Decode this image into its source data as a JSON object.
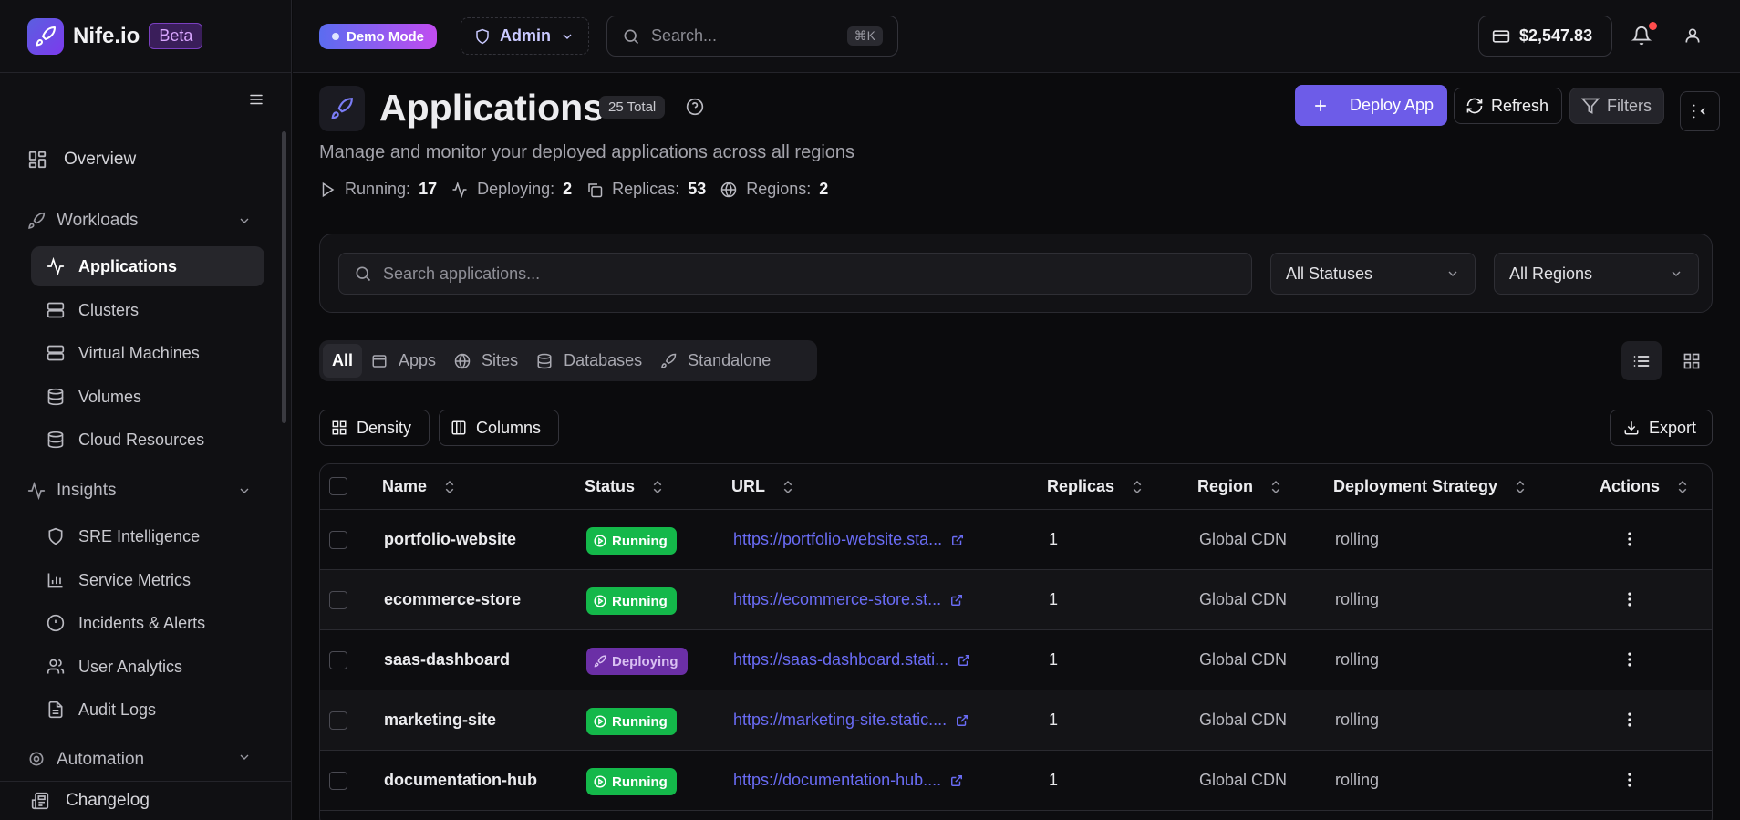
{
  "brand": {
    "name": "Nife.io",
    "badge": "Beta"
  },
  "sidebar": {
    "overview": "Overview",
    "groups": [
      {
        "label": "Workloads",
        "items": [
          "Applications",
          "Clusters",
          "Virtual Machines",
          "Volumes",
          "Cloud Resources"
        ]
      },
      {
        "label": "Insights",
        "items": [
          "SRE Intelligence",
          "Service Metrics",
          "Incidents & Alerts",
          "User Analytics",
          "Audit Logs"
        ]
      },
      {
        "label": "Automation"
      }
    ],
    "active_item": "Applications",
    "changelog": "Changelog"
  },
  "topbar": {
    "demo_mode": "Demo Mode",
    "role": "Admin",
    "search_placeholder": "Search...",
    "search_shortcut": "⌘K",
    "balance": "$2,547.83"
  },
  "page": {
    "title": "Applications",
    "total_badge": "25 Total",
    "subtitle": "Manage and monitor your deployed applications across all regions",
    "stats": [
      {
        "label": "Running:",
        "value": "17"
      },
      {
        "label": "Deploying:",
        "value": "2"
      },
      {
        "label": "Replicas:",
        "value": "53"
      },
      {
        "label": "Regions:",
        "value": "2"
      }
    ],
    "actions": {
      "deploy": "Deploy App",
      "refresh": "Refresh",
      "filters": "Filters"
    }
  },
  "filters": {
    "search_placeholder": "Search applications...",
    "status_select": "All Statuses",
    "region_select": "All Regions"
  },
  "type_tabs": [
    "All",
    "Apps",
    "Sites",
    "Databases",
    "Standalone"
  ],
  "toolbar": {
    "density": "Density",
    "columns": "Columns",
    "export": "Export"
  },
  "table": {
    "columns": [
      "Name",
      "Status",
      "URL",
      "Replicas",
      "Region",
      "Deployment Strategy",
      "Actions"
    ],
    "rows": [
      {
        "name": "portfolio-website",
        "status": "Running",
        "url": "https://portfolio-website.sta...",
        "replicas": "1",
        "region": "Global CDN",
        "strategy": "rolling"
      },
      {
        "name": "ecommerce-store",
        "status": "Running",
        "url": "https://ecommerce-store.st...",
        "replicas": "1",
        "region": "Global CDN",
        "strategy": "rolling"
      },
      {
        "name": "saas-dashboard",
        "status": "Deploying",
        "url": "https://saas-dashboard.stati...",
        "replicas": "1",
        "region": "Global CDN",
        "strategy": "rolling"
      },
      {
        "name": "marketing-site",
        "status": "Running",
        "url": "https://marketing-site.static....",
        "replicas": "1",
        "region": "Global CDN",
        "strategy": "rolling"
      },
      {
        "name": "documentation-hub",
        "status": "Running",
        "url": "https://documentation-hub....",
        "replicas": "1",
        "region": "Global CDN",
        "strategy": "rolling"
      }
    ]
  },
  "colors": {
    "accent": "#6d5ce8",
    "running": "#14b84a",
    "deploying": "#6b2fa6",
    "link": "#6a6cf5"
  }
}
